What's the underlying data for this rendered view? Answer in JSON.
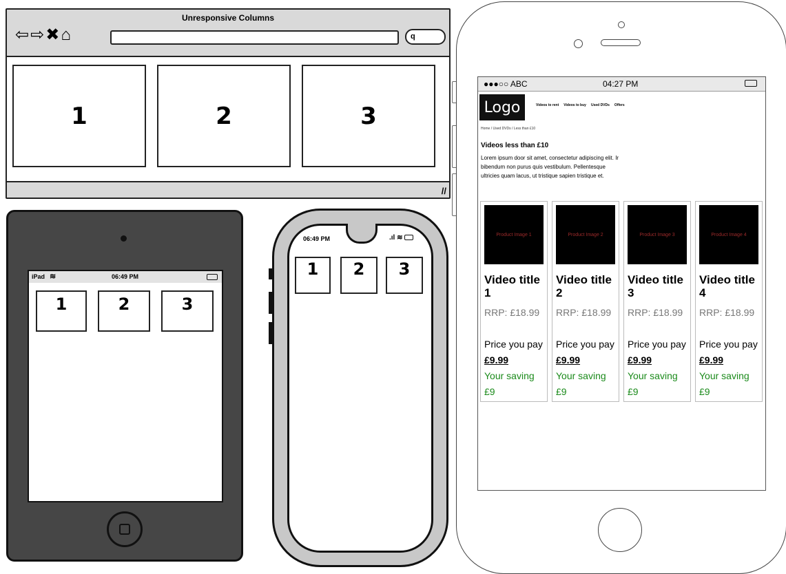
{
  "browser": {
    "title": "Unresponsive Columns",
    "columns": [
      "1",
      "2",
      "3"
    ],
    "nav_glyphs": "⇦⇨✖⌂",
    "search_glyph": "q"
  },
  "tablet": {
    "device_label": "iPad",
    "time": "06:49 PM",
    "columns": [
      "1",
      "2",
      "3"
    ]
  },
  "phone": {
    "time": "06:49 PM",
    "columns": [
      "1",
      "2",
      "3"
    ]
  },
  "iphone": {
    "carrier": "●●●○○ ABC",
    "time": "04:27 PM",
    "logo": "Logo",
    "nav": [
      "Videos to rent",
      "Videos to buy",
      "Used DVDs",
      "Offers"
    ],
    "breadcrumb": "Home   /   Used DVDs   /   Less than £10",
    "heading": "Videos less than £10",
    "intro": "Lorem ipsum door sit amet, consectetur adipiscing elit. Ir bibendum non purus quis vestibulum. Pellentesque ultricies quam lacus, ut tristique sapien tristique et.",
    "products": [
      {
        "image": "Product Image 1",
        "title": "Video title 1",
        "rrp": "RRP: £18.99",
        "pay_prefix": "Price you pay ",
        "price": "£9.99",
        "saving": "Your saving £9"
      },
      {
        "image": "Product Image 2",
        "title": "Video title 2",
        "rrp": "RRP: £18.99",
        "pay_prefix": "Price you pay ",
        "price": "£9.99",
        "saving": "Your saving £9"
      },
      {
        "image": "Product Image 3",
        "title": "Video title 3",
        "rrp": "RRP: £18.99",
        "pay_prefix": "Price you pay ",
        "price": "£9.99",
        "saving": "Your saving £9"
      },
      {
        "image": "Product Image 4",
        "title": "Video title 4",
        "rrp": "RRP: £18.99",
        "pay_prefix": "Price you pay ",
        "price": "£9.99",
        "saving": "Your saving £9"
      }
    ]
  },
  "colors": {
    "saving": "#1a8a1a",
    "device_dark": "#464646",
    "chrome_gray": "#d9d9d9"
  }
}
